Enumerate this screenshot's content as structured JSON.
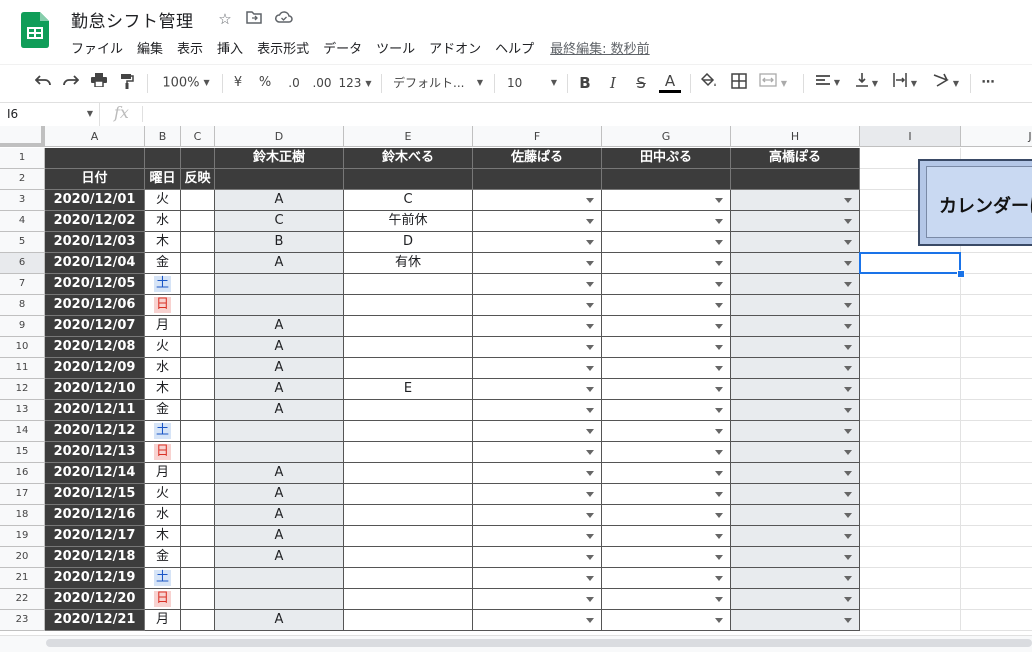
{
  "app": {
    "title": "勤怠シフト管理",
    "menu": [
      "ファイル",
      "編集",
      "表示",
      "挿入",
      "表示形式",
      "データ",
      "ツール",
      "アドオン",
      "ヘルプ"
    ],
    "last_edit": "最終編集: 数秒前"
  },
  "toolbar": {
    "zoom": "100%",
    "currency": "¥",
    "percent": "%",
    "decrease_decimal": ".0",
    "increase_decimal": ".00",
    "more_formats": "123",
    "font": "デフォルト...",
    "font_size": "10",
    "bold": "B",
    "italic": "I",
    "strike": "S",
    "text_color": "A",
    "more": "⋯"
  },
  "formula_bar": {
    "cell_ref": "I6",
    "fx": "fx",
    "value": ""
  },
  "columns": [
    "A",
    "B",
    "C",
    "D",
    "E",
    "F",
    "G",
    "H",
    "I",
    "J"
  ],
  "header_rows": {
    "row1": [
      "",
      "",
      "",
      "鈴木正樹",
      "鈴木べる",
      "佐藤ぱる",
      "田中ぷる",
      "高橋ぽる"
    ],
    "row2": [
      "日付",
      "曜日",
      "反映",
      "",
      "",
      "",
      "",
      ""
    ]
  },
  "rows": [
    {
      "n": "1"
    },
    {
      "n": "2"
    },
    {
      "n": "3",
      "date": "2020/12/01",
      "dow": "火",
      "d": "A",
      "e": "C"
    },
    {
      "n": "4",
      "date": "2020/12/02",
      "dow": "水",
      "d": "C",
      "e": "午前休"
    },
    {
      "n": "5",
      "date": "2020/12/03",
      "dow": "木",
      "d": "B",
      "e": "D"
    },
    {
      "n": "6",
      "date": "2020/12/04",
      "dow": "金",
      "d": "A",
      "e": "有休"
    },
    {
      "n": "7",
      "date": "2020/12/05",
      "dow": "土",
      "d": "",
      "e": ""
    },
    {
      "n": "8",
      "date": "2020/12/06",
      "dow": "日",
      "d": "",
      "e": ""
    },
    {
      "n": "9",
      "date": "2020/12/07",
      "dow": "月",
      "d": "A",
      "e": ""
    },
    {
      "n": "10",
      "date": "2020/12/08",
      "dow": "火",
      "d": "A",
      "e": ""
    },
    {
      "n": "11",
      "date": "2020/12/09",
      "dow": "水",
      "d": "A",
      "e": ""
    },
    {
      "n": "12",
      "date": "2020/12/10",
      "dow": "木",
      "d": "A",
      "e": "E"
    },
    {
      "n": "13",
      "date": "2020/12/11",
      "dow": "金",
      "d": "A",
      "e": ""
    },
    {
      "n": "14",
      "date": "2020/12/12",
      "dow": "土",
      "d": "",
      "e": ""
    },
    {
      "n": "15",
      "date": "2020/12/13",
      "dow": "日",
      "d": "",
      "e": ""
    },
    {
      "n": "16",
      "date": "2020/12/14",
      "dow": "月",
      "d": "A",
      "e": ""
    },
    {
      "n": "17",
      "date": "2020/12/15",
      "dow": "火",
      "d": "A",
      "e": ""
    },
    {
      "n": "18",
      "date": "2020/12/16",
      "dow": "水",
      "d": "A",
      "e": ""
    },
    {
      "n": "19",
      "date": "2020/12/17",
      "dow": "木",
      "d": "A",
      "e": ""
    },
    {
      "n": "20",
      "date": "2020/12/18",
      "dow": "金",
      "d": "A",
      "e": ""
    },
    {
      "n": "21",
      "date": "2020/12/19",
      "dow": "土",
      "d": "",
      "e": ""
    },
    {
      "n": "22",
      "date": "2020/12/20",
      "dow": "日",
      "d": "",
      "e": ""
    },
    {
      "n": "23",
      "date": "2020/12/21",
      "dow": "月",
      "d": "A",
      "e": ""
    }
  ],
  "calendar_button": {
    "label": "カレンダーに"
  },
  "colors": {
    "dark_header": "#3c3c3c",
    "grey_cell": "#e8ebee",
    "saturday": "#1a56c6",
    "sunday": "#d93025",
    "selection": "#1a73e8"
  }
}
